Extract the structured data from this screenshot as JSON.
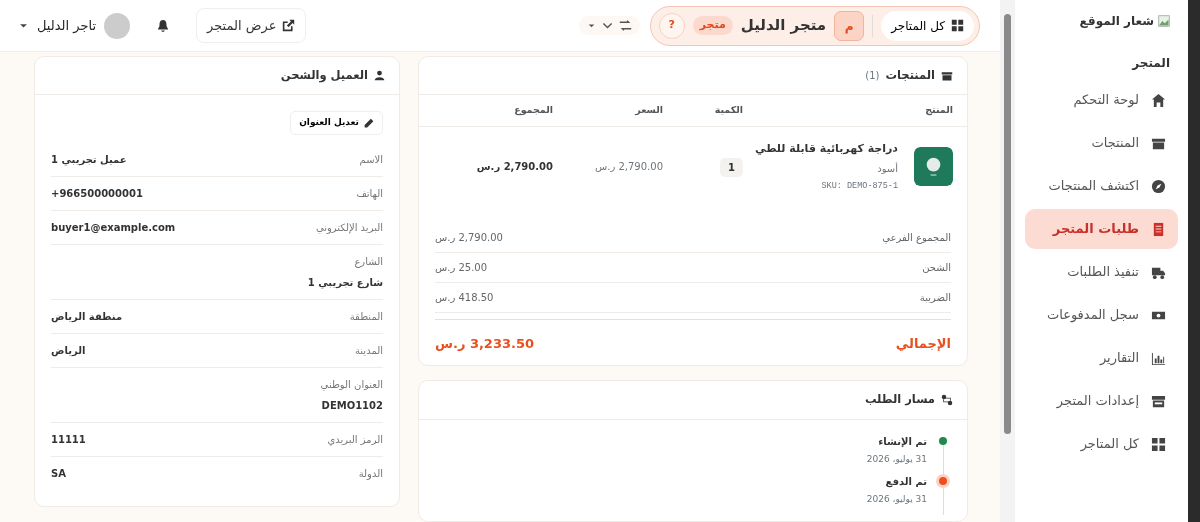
{
  "topbar": {
    "store_switcher": {
      "all_stores_label": "كل المتاجر",
      "initial": "م",
      "store_name": "متجر الدليل",
      "badge": "متجر",
      "help": "?"
    },
    "view_store_button": "عرض المتجر",
    "user": {
      "name": "تاجر الدليل"
    }
  },
  "sidebar": {
    "logo_text": "شعار الموقع",
    "section": "المتجر",
    "items": [
      {
        "label": "لوحة التحكم",
        "selected": false
      },
      {
        "label": "المنتجات",
        "selected": false
      },
      {
        "label": "اكتشف المنتجات",
        "selected": false
      },
      {
        "label": "طلبات المتجر",
        "selected": true
      },
      {
        "label": "تنفيذ الطلبات",
        "selected": false
      },
      {
        "label": "سجل المدفوعات",
        "selected": false
      },
      {
        "label": "التقارير",
        "selected": false
      },
      {
        "label": "إعدادات المتجر",
        "selected": false
      },
      {
        "label": "كل المتاجر",
        "selected": false
      }
    ]
  },
  "products_card": {
    "title": "المنتجات",
    "count": "(1)",
    "columns": [
      "المنتج",
      "الكمية",
      "السعر",
      "المجموع"
    ],
    "items": [
      {
        "name": "دراجة كهربائية قابلة للطي",
        "variant": "أسود",
        "sku": "SKU: DEMO-875-1",
        "quantity": "1",
        "price": "2,790.00 ر.س",
        "total": "2,790.00 ر.س"
      }
    ],
    "summary": [
      {
        "label": "المجموع الفرعي",
        "value": "2,790.00 ر.س"
      },
      {
        "label": "الشحن",
        "value": "25.00 ر.س"
      },
      {
        "label": "الضريبة",
        "value": "418.50 ر.س"
      }
    ],
    "total": {
      "label": "الإجمالي",
      "value": "3,233.50 ر.س"
    }
  },
  "timeline_card": {
    "title": "مسار الطلب",
    "events": [
      {
        "label": "تم الإنشاء",
        "date": "31 يوليو، 2026",
        "color": "#1e8a4c",
        "current": false
      },
      {
        "label": "تم الدفع",
        "date": "31 يوليو، 2026",
        "color": "#f04e1c",
        "current": true
      }
    ]
  },
  "customer_card": {
    "title": "العميل والشحن",
    "edit_button": "تعديل العنوان",
    "fields": [
      {
        "kind": "inline",
        "label": "الاسم",
        "value": "عميل تجريبي 1"
      },
      {
        "kind": "inline",
        "label": "الهاتف",
        "value": "+966500000001"
      },
      {
        "kind": "inline",
        "label": "البريد الإلكتروني",
        "value": "buyer1@example.com"
      },
      {
        "kind": "stacked",
        "label": "الشارع",
        "value": "شارع تجريبي 1"
      },
      {
        "kind": "inline",
        "label": "المنطقة",
        "value": "منطقة الرياض"
      },
      {
        "kind": "inline",
        "label": "المدينة",
        "value": "الرياض"
      },
      {
        "kind": "stacked",
        "label": "العنوان الوطني",
        "value": "DEMO1102"
      },
      {
        "kind": "inline",
        "label": "الرمز البريدي",
        "value": "11111"
      },
      {
        "kind": "inline",
        "label": "الدولة",
        "value": "SA"
      }
    ]
  }
}
